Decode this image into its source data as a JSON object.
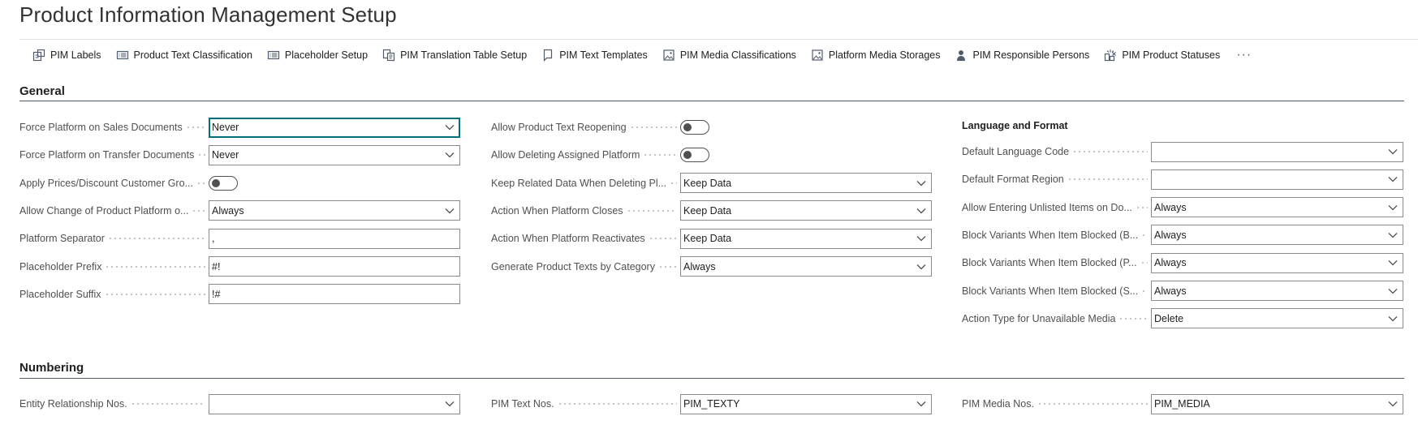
{
  "page": {
    "title": "Product Information Management Setup"
  },
  "actions": [
    {
      "label": "PIM Labels",
      "icon": "labels-icon"
    },
    {
      "label": "Product Text Classification",
      "icon": "list-icon"
    },
    {
      "label": "Placeholder Setup",
      "icon": "list-icon"
    },
    {
      "label": "PIM Translation Table Setup",
      "icon": "translate-icon"
    },
    {
      "label": "PIM Text Templates",
      "icon": "document-icon"
    },
    {
      "label": "PIM Media Classifications",
      "icon": "image-icon"
    },
    {
      "label": "Platform Media Storages",
      "icon": "image-icon"
    },
    {
      "label": "PIM Responsible Persons",
      "icon": "person-icon"
    },
    {
      "label": "PIM Product Statuses",
      "icon": "status-icon"
    }
  ],
  "more_label": "···",
  "general": {
    "title": "General",
    "col1": [
      {
        "label": "Force Platform on Sales Documents",
        "type": "select",
        "value": "Never"
      },
      {
        "label": "Force Platform on Transfer Documents",
        "type": "select",
        "value": "Never"
      },
      {
        "label": "Apply Prices/Discount Customer Gro...",
        "type": "toggle",
        "value": ""
      },
      {
        "label": "Allow Change of Product Platform o...",
        "type": "select",
        "value": "Always"
      },
      {
        "label": "Platform Separator",
        "type": "text",
        "value": ","
      },
      {
        "label": "Placeholder Prefix",
        "type": "text",
        "value": "#!"
      },
      {
        "label": "Placeholder Suffix",
        "type": "text",
        "value": "!#"
      }
    ],
    "col2": [
      {
        "label": "Allow Product Text Reopening",
        "type": "toggle",
        "value": ""
      },
      {
        "label": "Allow Deleting Assigned Platform",
        "type": "toggle",
        "value": ""
      },
      {
        "label": "Keep Related Data When Deleting Pl...",
        "type": "select",
        "value": "Keep Data"
      },
      {
        "label": "Action When Platform Closes",
        "type": "select",
        "value": "Keep Data"
      },
      {
        "label": "Action When Platform Reactivates",
        "type": "select",
        "value": "Keep Data"
      },
      {
        "label": "Generate Product Texts by Category",
        "type": "select",
        "value": "Always"
      }
    ],
    "col3_title": "Language and Format",
    "col3": [
      {
        "label": "Default Language Code",
        "type": "select",
        "value": ""
      },
      {
        "label": "Default Format Region",
        "type": "select",
        "value": ""
      },
      {
        "label": "Allow Entering Unlisted Items on Do...",
        "type": "select",
        "value": "Always"
      },
      {
        "label": "Block Variants When Item Blocked (B...",
        "type": "select",
        "value": "Always"
      },
      {
        "label": "Block Variants When Item Blocked (P...",
        "type": "select",
        "value": "Always"
      },
      {
        "label": "Block Variants When Item Blocked (S...",
        "type": "select",
        "value": "Always"
      },
      {
        "label": "Action Type for Unavailable Media",
        "type": "select",
        "value": "Delete"
      }
    ]
  },
  "numbering": {
    "title": "Numbering",
    "fields": [
      {
        "label": "Entity Relationship Nos.",
        "type": "select",
        "value": ""
      },
      {
        "label": "PIM Text Nos.",
        "type": "select",
        "value": "PIM_TEXTY"
      },
      {
        "label": "PIM Media Nos.",
        "type": "select",
        "value": "PIM_MEDIA"
      }
    ]
  }
}
